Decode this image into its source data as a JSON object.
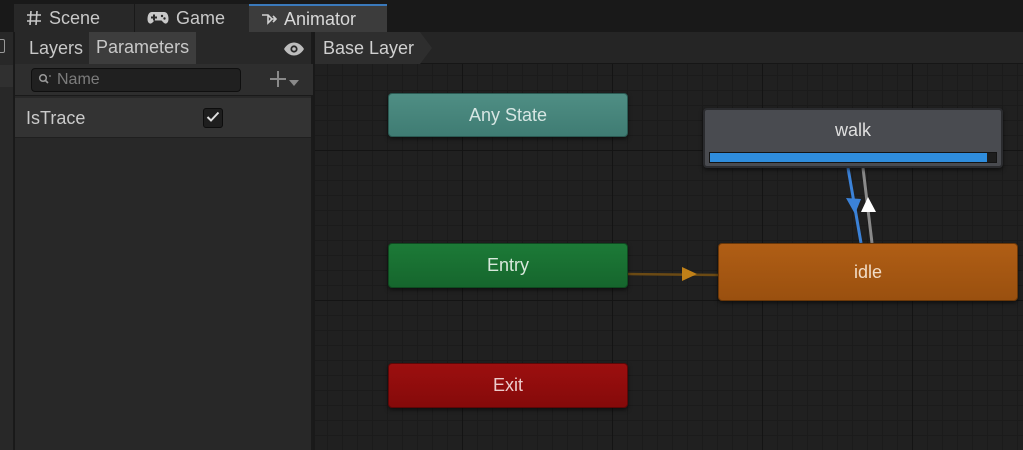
{
  "tabs": [
    {
      "label": "Scene",
      "icon": "hash-icon"
    },
    {
      "label": "Game",
      "icon": "gamepad-icon"
    },
    {
      "label": "Animator",
      "icon": "animator-icon",
      "active": true
    }
  ],
  "panel": {
    "tabs": [
      "Layers",
      "Parameters"
    ],
    "active_tab": "Parameters",
    "search_placeholder": "Name",
    "parameters": [
      {
        "name": "IsTrace",
        "type": "bool",
        "value": true
      }
    ]
  },
  "graph": {
    "breadcrumb": "Base Layer",
    "states": {
      "any": "Any State",
      "entry": "Entry",
      "exit": "Exit",
      "idle": "idle",
      "walk": "walk"
    },
    "walk_progress": 0.97,
    "colors": {
      "any_state": "#4a887e",
      "entry": "#197233",
      "exit": "#930d0d",
      "default_state": "#a55814",
      "state": "#494b50",
      "progress": "#2f8ddd",
      "active_transition": "#3b82d8"
    }
  }
}
